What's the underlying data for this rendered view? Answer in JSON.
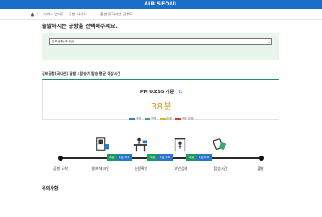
{
  "header": {
    "brand": "AIR SEOUL"
  },
  "breadcrumb": {
    "items": [
      "서비스 안내",
      "공항 서비스",
      "출발일/국제선 공항도"
    ]
  },
  "page": {
    "title": "출발하시는 공항을 선택해주세요.",
    "airport_select": {
      "value": "김포공항(국내선)",
      "arrow": "▾"
    },
    "wait_subtitle": "김포공항(국내선) 출발 : 탑승기 탑승 평균 예상시간"
  },
  "wait": {
    "reference_time": "PM 03:55 기준",
    "minutes": "38분",
    "legend": [
      {
        "label": "여유",
        "color": "#2f86c9"
      },
      {
        "label": "보통",
        "color": "#3aa66a"
      },
      {
        "label": "혼잡",
        "color": "#e3b21f"
      },
      {
        "label": "매우 혼잡",
        "color": "#d83a3a"
      }
    ]
  },
  "steps": {
    "labels": [
      "공항 도착",
      "셀프 체크인",
      "신원확인",
      "보안검색",
      "탑승시간",
      "출발"
    ],
    "badges": [
      {
        "left": "여유",
        "right": "1분 소요"
      },
      {
        "left": "여유",
        "right": "1분 소요"
      },
      {
        "left": "여유",
        "right": "1분 소요"
      }
    ],
    "icons": [
      "self-checkin-icon",
      "id-check-icon",
      "security-scan-icon",
      "boarding-icon"
    ]
  },
  "notes": {
    "title": "유의사항"
  },
  "colors": {
    "brand_bar": "#1b6ec8",
    "accent_green": "#16946f",
    "wait_value": "#d59a2c"
  }
}
